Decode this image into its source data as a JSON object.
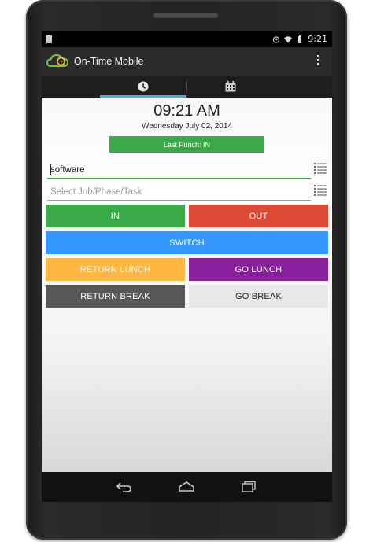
{
  "status_bar": {
    "time": "9:21"
  },
  "app": {
    "title": "On-Time Mobile"
  },
  "tabs": [
    {
      "icon": "clock-icon",
      "selected": true
    },
    {
      "icon": "calendar-icon",
      "selected": false
    }
  ],
  "clock": {
    "time": "09:21 AM",
    "date": "Wednesday July 02, 2014"
  },
  "last_punch": {
    "label": "Last Punch: IN"
  },
  "fields": {
    "department": {
      "value": "software"
    },
    "job": {
      "placeholder": "Select Job/Phase/Task"
    }
  },
  "buttons": {
    "in": "IN",
    "out": "OUT",
    "switch": "SWITCH",
    "return_lunch": "RETURN LUNCH",
    "go_lunch": "GO LUNCH",
    "return_break": "RETURN BREAK",
    "go_break": "GO BREAK"
  },
  "colors": {
    "green": "#3aaa48",
    "red": "#dc4937",
    "blue": "#3399ff",
    "orange": "#ffb643",
    "purple": "#8a1f9c",
    "dark_gray": "#575757",
    "light_gray": "#e8e8e8",
    "tab_accent": "#33b5e5"
  }
}
